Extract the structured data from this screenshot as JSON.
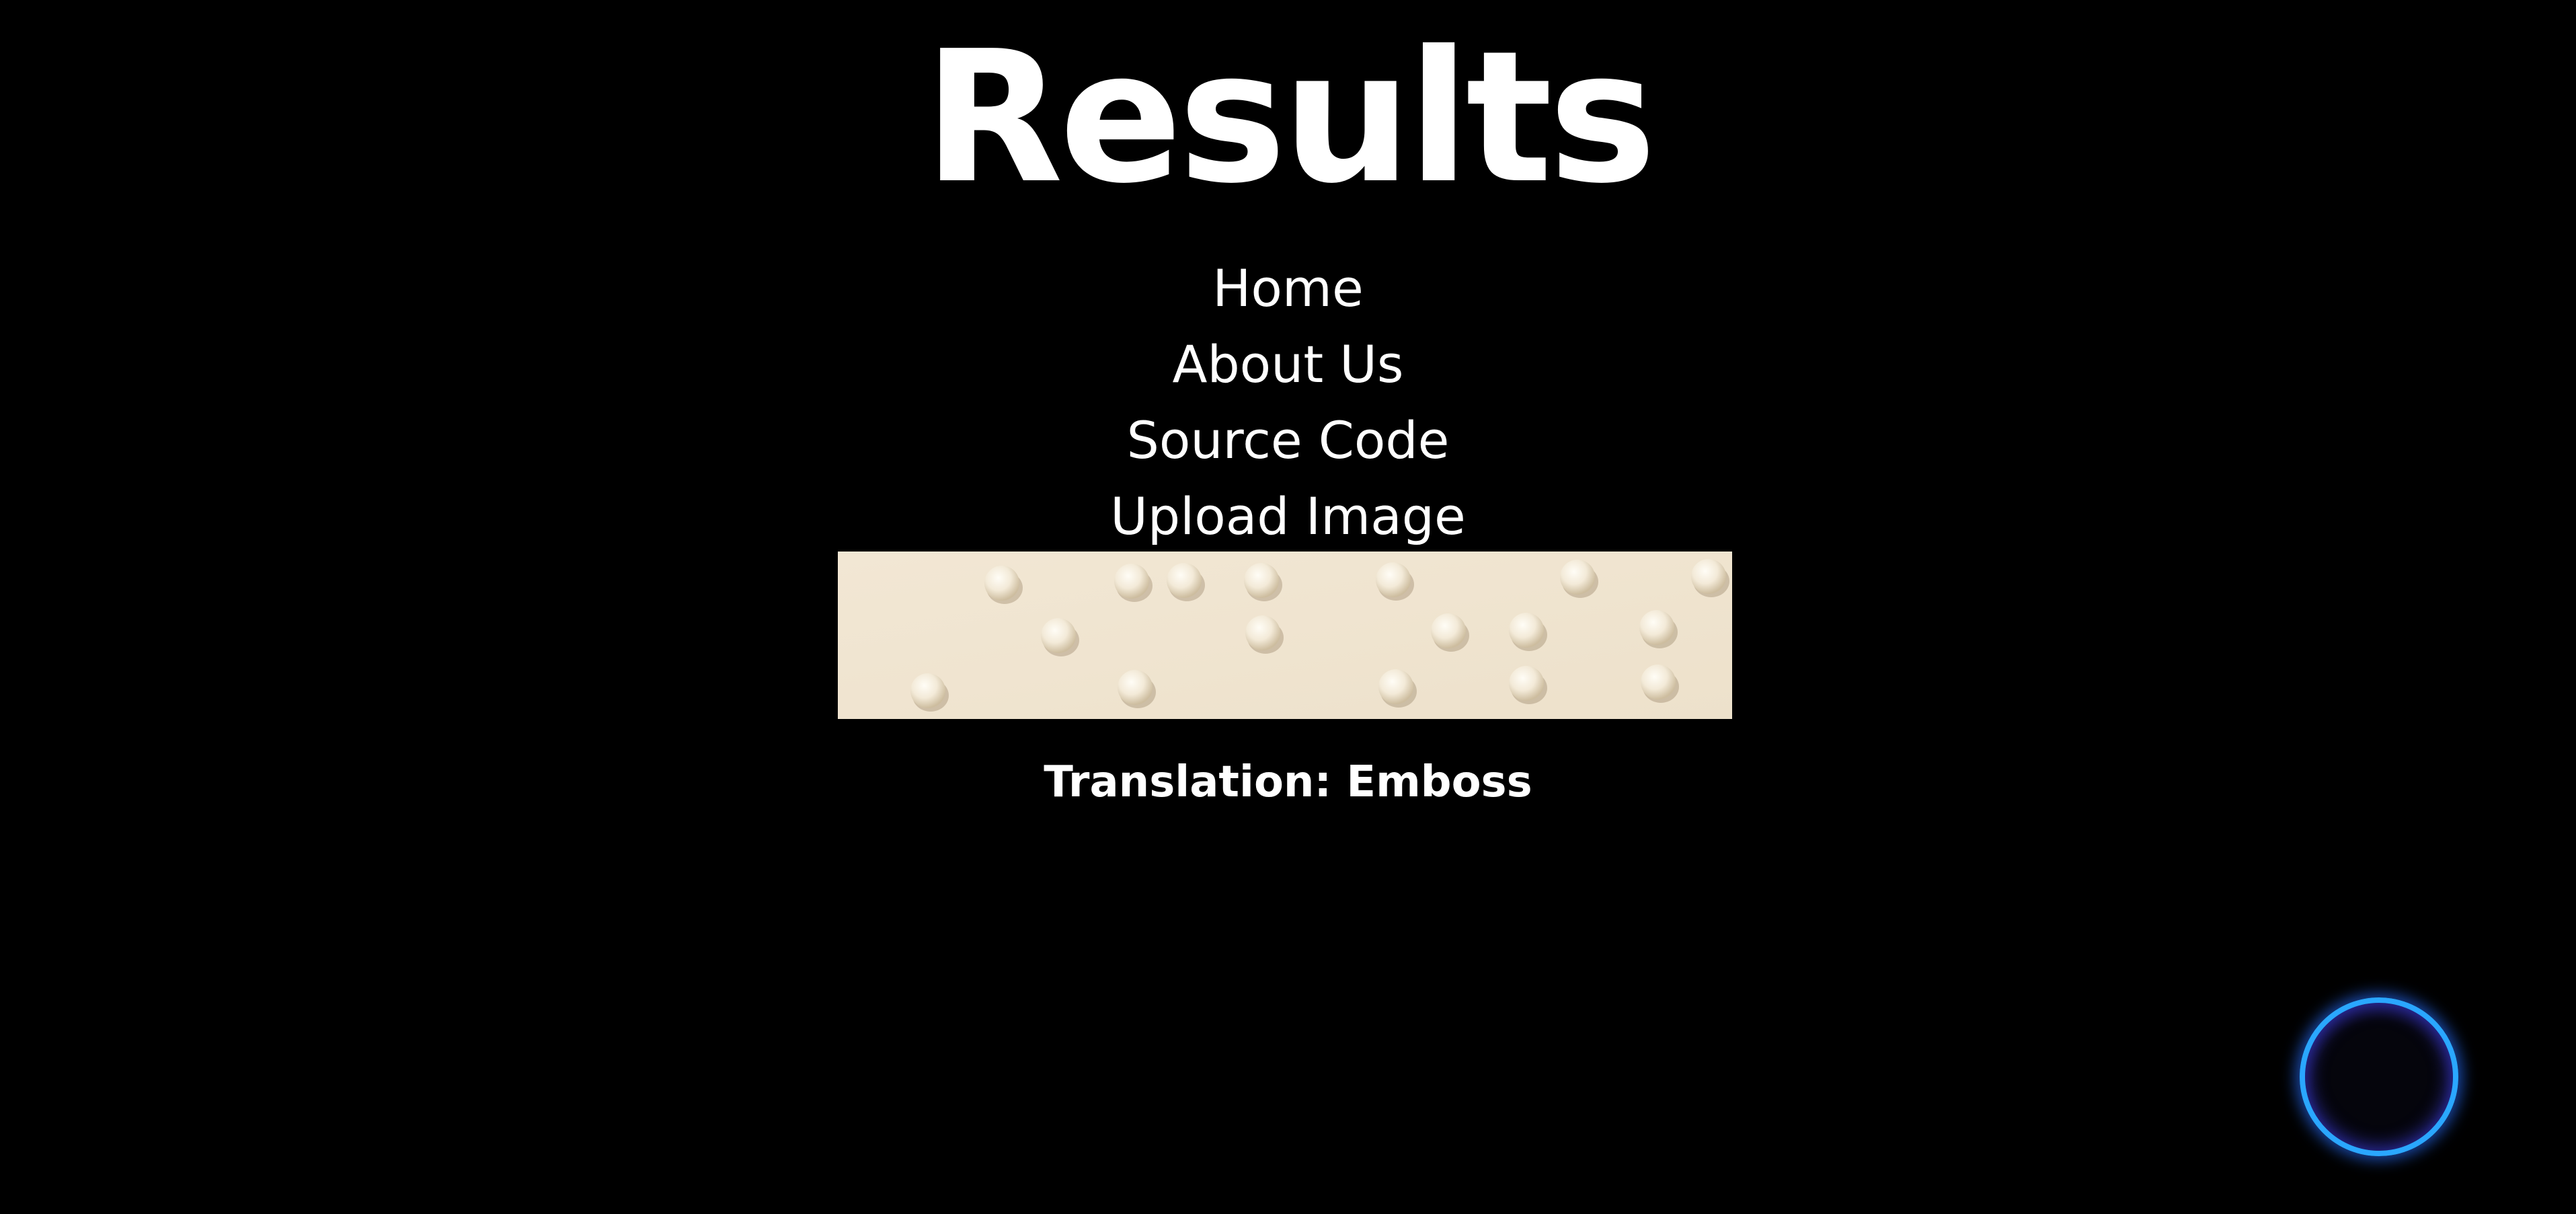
{
  "header": {
    "title": "Results"
  },
  "nav": {
    "items": [
      {
        "label": "Home"
      },
      {
        "label": "About Us"
      },
      {
        "label": "Source Code"
      },
      {
        "label": "Upload Image"
      }
    ]
  },
  "result": {
    "image_subject": "embossed braille dots on paper",
    "translation_text": "Translation: Emboss"
  },
  "record_button": {
    "icon": "circle-ring-icon"
  },
  "colors": {
    "background": "#000000",
    "text": "#ffffff",
    "paper": "#f1e6d3",
    "accent_ring": "#2aa7ff"
  }
}
